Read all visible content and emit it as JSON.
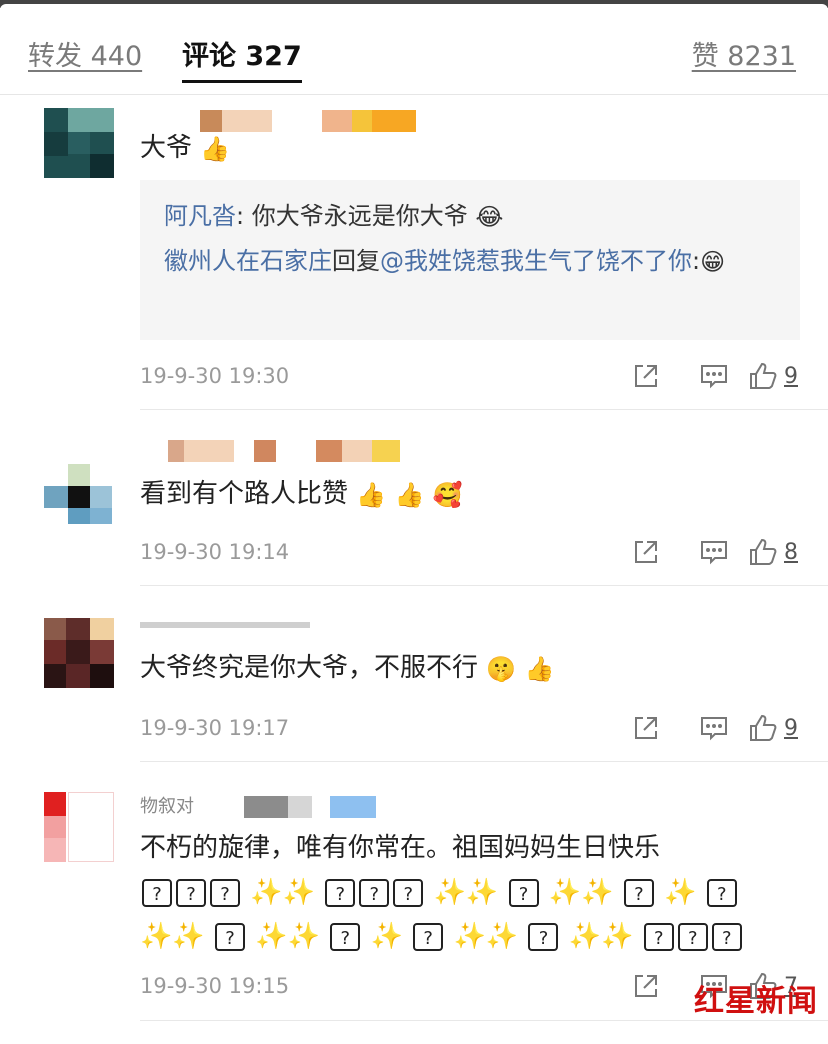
{
  "tabs": {
    "repost": "转发 440",
    "comments": "评论 327",
    "likes": "赞 8231"
  },
  "comments": [
    {
      "text": "大爷",
      "emojis": [
        "thumbs-up"
      ],
      "quote": {
        "line1_name": "阿凡沓",
        "line1_text": ": 你大爷永远是你大爷",
        "line2_name": "徽州人在石家庄",
        "line2_mid": "回复",
        "line2_mention": "@我姓饶惹我生气了饶不了你",
        "line2_end": ":"
      },
      "time": "19-9-30 19:30",
      "likes": "9"
    },
    {
      "text": "看到有个路人比赞",
      "emojis": [
        "thumbs-up",
        "thumbs-up",
        "love-face"
      ],
      "time": "19-9-30 19:14",
      "likes": "8"
    },
    {
      "text": "大爷终究是你大爷，不服不行",
      "emojis": [
        "shush-face",
        "thumbs-up"
      ],
      "time": "19-9-30 19:17",
      "likes": "9"
    },
    {
      "text": "不朽的旋律，唯有你常在。祖国妈妈生日快乐",
      "username_partial": "物叙对",
      "time": "19-9-30 19:15",
      "likes": "7"
    }
  ],
  "watermark": "红星新闻",
  "colors": {
    "link": "#4a6fa5",
    "watermark": "#d01010",
    "sparkle": "#f5c400"
  }
}
